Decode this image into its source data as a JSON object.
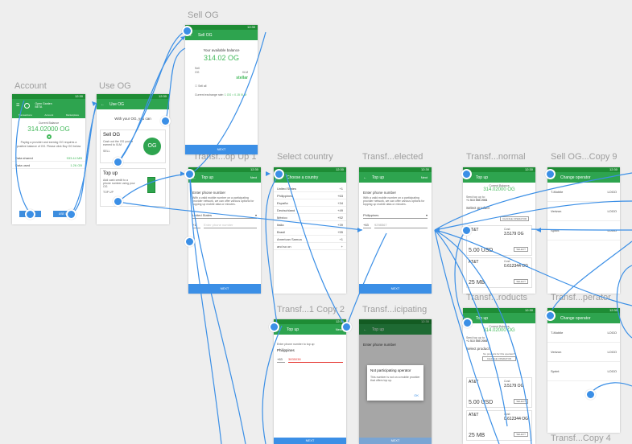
{
  "boards": {
    "account": "Account",
    "use_og": "Use OG",
    "sell_og": "Sell OG",
    "transf_op_up_1": "Transf...op Up 1",
    "select_country": "Select country",
    "transf_elected": "Transf...elected",
    "transf_normal": "Transf...normal",
    "sell_og_copy_9": "Sell OG...Copy 9",
    "transf_1_copy_2": "Transf...1 Copy 2",
    "transf_icipating": "Transf...icipating",
    "transf_roducts": "Transf...roducts",
    "transf_perator": "Transf...perator",
    "transf_copy_4": "Transf...Copy 4"
  },
  "account": {
    "tabs": [
      "Transactions",
      "Account",
      "Marketplace"
    ],
    "logo_name": "Open Garden",
    "logo_badge": "BETA",
    "balance_label": "Current Balance",
    "balance": "314.02000 OG",
    "note": "Paying a provider and earning OG requires a positive balance of OG. Please click Buy OG below",
    "rows": [
      {
        "label": "Data shared",
        "value": "933.44 MB"
      },
      {
        "label": "Data used",
        "value": "1.26 GB"
      }
    ],
    "buy_button": "BUY OG",
    "use_button": "USE OG"
  },
  "use_og": {
    "title": "Use OG",
    "intro": "With your OG, you can",
    "sell_title": "Sell OG",
    "sell_desc": "Cash out the OG you've earned to XLM",
    "sell_action": "SELL",
    "topup_title": "Top up",
    "topup_desc": "Add cash credit to a phone number using your OG",
    "topup_action": "TOP UP",
    "og_badge": "OG"
  },
  "sell_og": {
    "title": "Sell OG",
    "balance_label": "Your available balance",
    "balance": "314.02 OG",
    "sell_label": "Sell",
    "from": "OG",
    "to": "XLM",
    "brand": "stellar",
    "sell_all": "Sell all",
    "rate_label": "Current exchange rate:",
    "rate": "1 OG = 0.15 XLM",
    "next": "NEXT"
  },
  "topup1": {
    "title": "Top up",
    "action": "Next",
    "heading": "Enter phone number",
    "desc": "With a valid mobile number on a participating provider network, we can offer various options for topping up mobile data or minutes.",
    "country": "United States",
    "code": "+1",
    "placeholder": "Enter phone number",
    "next": "NEXT"
  },
  "country": {
    "title": "Choose a country",
    "items": [
      {
        "name": "United States",
        "code": "+1"
      },
      {
        "name": "Philippines",
        "code": "+63"
      },
      {
        "name": "España",
        "code": "+34"
      },
      {
        "name": "Deutschland",
        "code": "+49"
      },
      {
        "name": "México",
        "code": "+52"
      },
      {
        "name": "Italia",
        "code": "+39"
      },
      {
        "name": "Brasil",
        "code": "+55"
      },
      {
        "name": "American Samoa",
        "code": "+1"
      },
      {
        "name": "and so on",
        "code": "+"
      }
    ]
  },
  "selected": {
    "title": "Top up",
    "action": "Next",
    "heading": "Enter phone number",
    "desc": "With a valid mobile number on a participating provider network, we can offer various options for topping up mobile data or minutes.",
    "country": "Philippines",
    "code": "+63",
    "number": "9298567",
    "next": "NEXT"
  },
  "normal": {
    "title": "Top up",
    "balance_label": "Current Balance",
    "balance": "314.02000 OG",
    "send_label": "Send top up to:",
    "phone": "+1 510 555 2984",
    "select": "Select product",
    "change": "CHANGE OPERATOR",
    "products": [
      {
        "brand": "AT&T",
        "price": "5.00 USD",
        "cost_label": "Cost:",
        "cost": "3.5179 OG",
        "select": "SELECT"
      },
      {
        "brand": "AT&T",
        "price": "25 MB",
        "cost_label": "Cost:",
        "cost": "0.612344 OG",
        "select": "SELECT"
      }
    ]
  },
  "copy9": {
    "title": "Change operator",
    "items": [
      {
        "name": "T-Mobile",
        "logo": "LOGO"
      },
      {
        "name": "Verizon",
        "logo": "LOGO"
      },
      {
        "name": "Sprint",
        "logo": "LOGO"
      }
    ]
  },
  "copy2": {
    "title": "Top up",
    "action": "Next",
    "heading": "Enter phone number to top up",
    "country": "Philippines",
    "code": "+63",
    "number": "3835038",
    "next": "NEXT"
  },
  "icipating": {
    "title": "Top up",
    "heading": "Enter phone number",
    "dialog_title": "Not participating operator",
    "dialog_body": "This number is not on a mobile provider that offers top up.",
    "dialog_ok": "OK",
    "next": "NEXT"
  },
  "roducts": {
    "title": "Top up",
    "balance_label": "Current Balance",
    "balance": "314.02000 OG",
    "send_label": "Send top up to:",
    "phone": "+1 510 555 2984",
    "select": "Select product",
    "no_products": "No products for this operator?",
    "change": "CHANGE OPERATOR",
    "products": [
      {
        "brand": "AT&T",
        "price": "5.00 USD",
        "cost_label": "Cost:",
        "cost": "3.5179 OG",
        "select": "SELECT"
      },
      {
        "brand": "AT&T",
        "price": "25 MB",
        "cost_label": "Cost:",
        "cost": "0.612344 OG",
        "select": "SELECT"
      }
    ]
  },
  "perator": {
    "title": "Change operator",
    "items": [
      {
        "name": "T-Mobile",
        "logo": "LOGO"
      },
      {
        "name": "Verizon",
        "logo": "LOGO"
      },
      {
        "name": "Sprint",
        "logo": "LOGO"
      }
    ]
  },
  "statusbar_time": "12:30",
  "colors": {
    "brand_green": "#2ea44f",
    "accent_blue": "#3b8fe6",
    "canvas": "#eeeeee"
  }
}
